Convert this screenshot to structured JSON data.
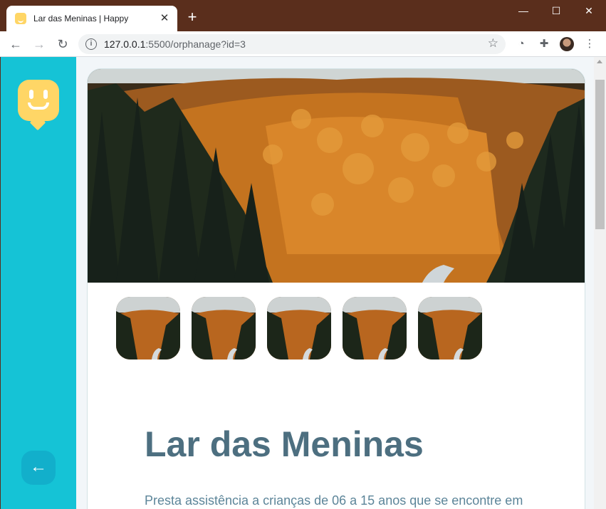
{
  "browser": {
    "tab_title": "Lar das Meninas | Happy",
    "url_host": "127.0.0.1",
    "url_rest": ":5500/orphanage?id=3"
  },
  "orphanage": {
    "name": "Lar das Meninas",
    "description": "Presta assistência a crianças de 06 a 15 anos que se encontre em"
  },
  "colors": {
    "sidebar": "#15c3d6",
    "title": "#4d6f80",
    "text": "#5c8599",
    "logo": "#ffd666"
  }
}
